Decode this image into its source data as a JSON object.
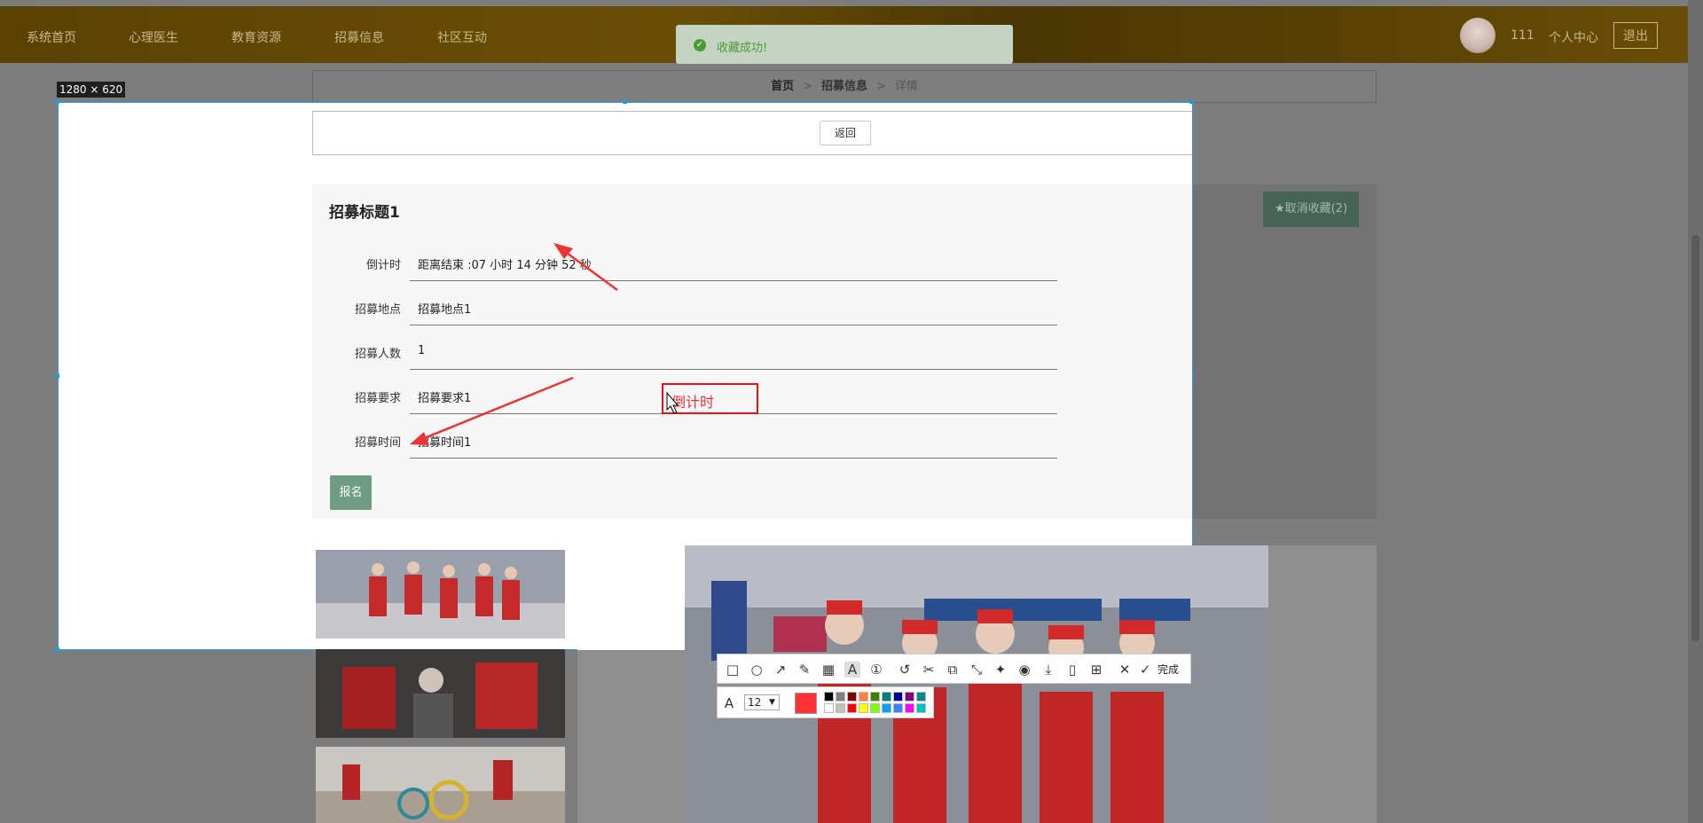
{
  "nav": {
    "items": [
      "系统首页",
      "心理医生",
      "教育资源",
      "招募信息",
      "社区互动"
    ],
    "username": "111",
    "personal_center": "个人中心",
    "logout": "退出"
  },
  "toast": {
    "icon": "check-circle-icon",
    "text": "收藏成功!"
  },
  "breadcrumb": {
    "home": "首页",
    "section": "招募信息",
    "current": "详情",
    "separator": ">"
  },
  "screenshot_tool": {
    "size_label": "1280 × 620",
    "font_size_value": "12",
    "done_label": "完成",
    "active_color": "#ff3333",
    "palette": [
      "#000000",
      "#808080",
      "#800000",
      "#ff8040",
      "#408000",
      "#008080",
      "#0000a0",
      "#800080",
      "#008b8b",
      "#ffffff",
      "#c0c0c0",
      "#ff0000",
      "#ffff00",
      "#80ff00",
      "#00a0ff",
      "#4080ff",
      "#ff00ff",
      "#00c0c0"
    ],
    "icons": [
      "rectangle-icon",
      "ellipse-icon",
      "arrow-icon",
      "pen-icon",
      "mosaic-icon",
      "text-icon",
      "number-icon",
      "undo-icon",
      "cut-icon",
      "ocr-icon",
      "translate-icon",
      "pin-icon",
      "record-icon",
      "download-icon",
      "phone-icon",
      "save-icon",
      "close-icon",
      "check-icon"
    ]
  },
  "detail": {
    "back_label": "返回",
    "title": "招募标题1",
    "fields": [
      {
        "label": "倒计时",
        "value": "距离结束 :07 小时 14 分钟 52 秒"
      },
      {
        "label": "招募地点",
        "value": "招募地点1"
      },
      {
        "label": "招募人数",
        "value": "1"
      },
      {
        "label": "招募要求",
        "value": "招募要求1"
      },
      {
        "label": "招募时间",
        "value": "招募时间1"
      }
    ],
    "signup_label": "报名",
    "favorite_label": "★取消收藏(2)",
    "annotation_text": "倒计时"
  }
}
